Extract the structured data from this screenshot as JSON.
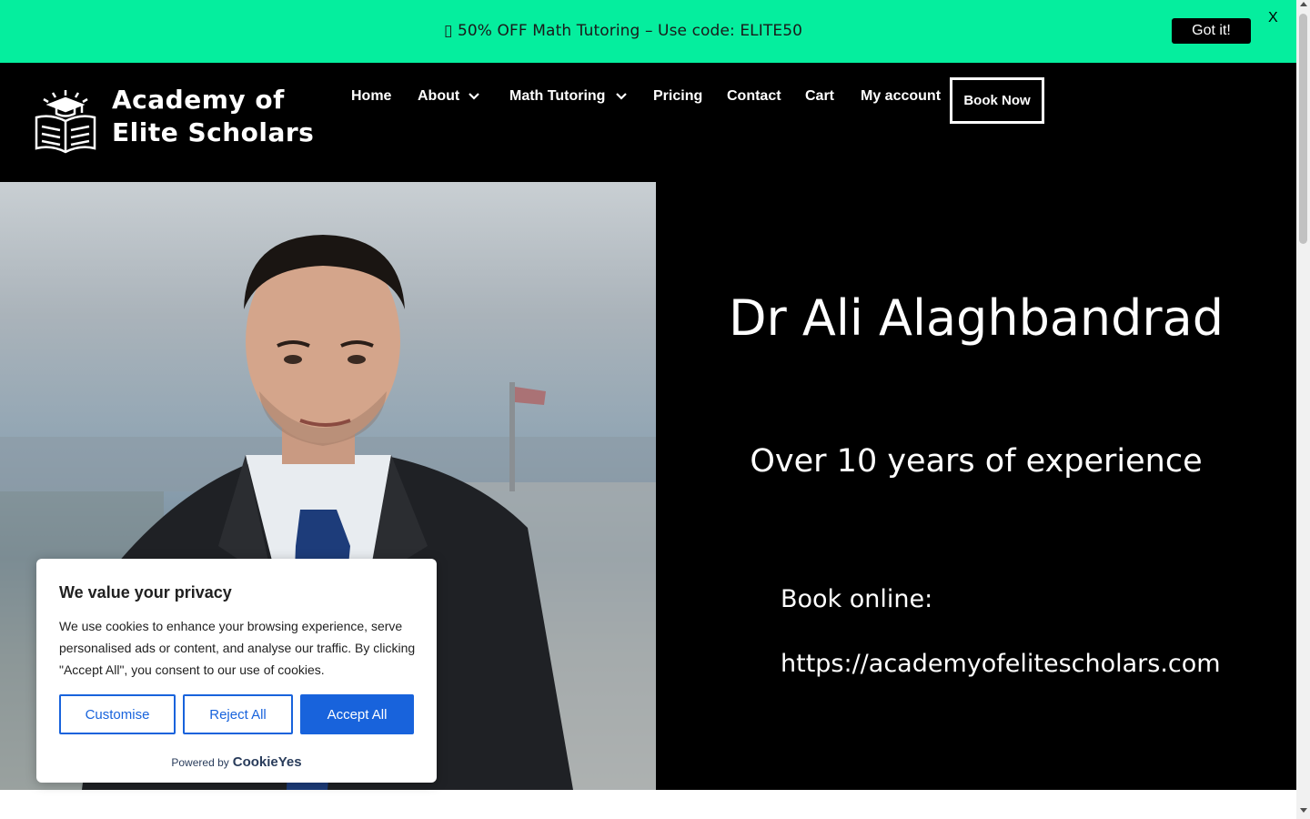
{
  "promo": {
    "text": "▯ 50% OFF Math Tutoring – Use code: ELITE50",
    "button_label": "Got it!",
    "close_label": "X",
    "bg_color": "#05ee9e"
  },
  "header": {
    "logo_line1": "Academy of",
    "logo_line2": "Elite Scholars",
    "logo_icon": "book-graduation-cap-icon",
    "nav": [
      {
        "label": "Home"
      },
      {
        "label": "About",
        "has_dropdown": true
      },
      {
        "label": "Math Tutoring",
        "has_dropdown": true
      },
      {
        "label": "Pricing"
      },
      {
        "label": "Contact"
      },
      {
        "label": "Cart"
      },
      {
        "label": "My account"
      }
    ],
    "book_button": "Book Now"
  },
  "hero": {
    "title": "Dr Ali Alaghbandrad",
    "subtitle": "Over 10 years of experience",
    "book_label": "Book online:",
    "url": "https://academyofelitescholars.com"
  },
  "cookie": {
    "title": "We value your privacy",
    "text": "We use cookies to enhance your browsing experience, serve personalised ads or content, and analyse our traffic. By clicking \"Accept All\", you consent to our use of cookies.",
    "customise": "Customise",
    "reject": "Reject All",
    "accept": "Accept All",
    "powered_by": "Powered by",
    "brand": "CookieYes",
    "accent_color": "#1863dc"
  }
}
